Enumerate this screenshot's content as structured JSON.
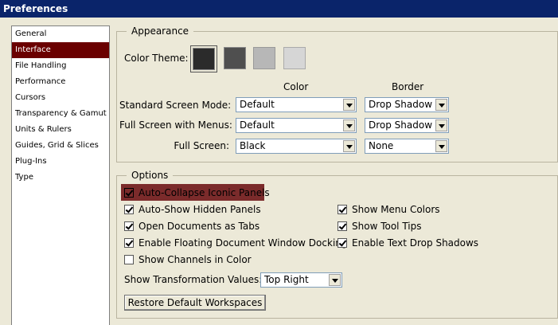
{
  "window": {
    "title": "Preferences"
  },
  "sidebar": {
    "items": [
      {
        "label": "General"
      },
      {
        "label": "Interface"
      },
      {
        "label": "File Handling"
      },
      {
        "label": "Performance"
      },
      {
        "label": "Cursors"
      },
      {
        "label": "Transparency & Gamut"
      },
      {
        "label": "Units & Rulers"
      },
      {
        "label": "Guides, Grid & Slices"
      },
      {
        "label": "Plug-Ins"
      },
      {
        "label": "Type"
      }
    ],
    "selected": "Interface"
  },
  "appearance": {
    "title": "Appearance",
    "color_theme_label": "Color Theme:",
    "themes": [
      {
        "name": "darkest",
        "color": "#2b2b2b"
      },
      {
        "name": "dark",
        "color": "#4f4f4f"
      },
      {
        "name": "light",
        "color": "#b7b7b7"
      },
      {
        "name": "lightest",
        "color": "#d6d6d6"
      }
    ],
    "selected_theme": "darkest",
    "col_color": "Color",
    "col_border": "Border",
    "modes": [
      {
        "label": "Standard Screen Mode:",
        "color": "Default",
        "border": "Drop Shadow"
      },
      {
        "label": "Full Screen with Menus:",
        "color": "Default",
        "border": "Drop Shadow"
      },
      {
        "label": "Full Screen:",
        "color": "Black",
        "border": "None"
      }
    ]
  },
  "options": {
    "title": "Options",
    "left_checks": [
      {
        "label": "Auto-Collapse Iconic Panels",
        "checked": true,
        "highlighted": true
      },
      {
        "label": "Auto-Show Hidden Panels",
        "checked": true
      },
      {
        "label": "Open Documents as Tabs",
        "checked": true
      },
      {
        "label": "Enable Floating Document Window Docking",
        "checked": true
      },
      {
        "label": "Show Channels in Color",
        "checked": false
      }
    ],
    "right_checks": [
      {
        "label": "Show Menu Colors",
        "checked": true
      },
      {
        "label": "Show Tool Tips",
        "checked": true
      },
      {
        "label": "Enable Text Drop Shadows",
        "checked": true
      }
    ],
    "transform_label": "Show Transformation Values:",
    "transform_value": "Top Right",
    "restore_button": "Restore Default Workspaces"
  },
  "colors": {
    "titlebar": "#0a246a",
    "selection": "#6a0000",
    "highlight": "#7b2b2b"
  }
}
